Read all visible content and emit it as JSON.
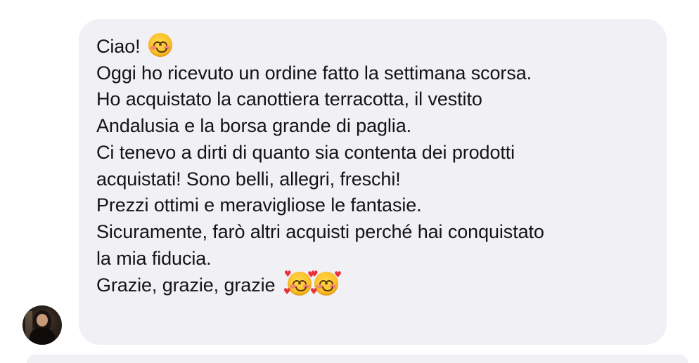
{
  "message": {
    "lines": [
      "Ciao!",
      "Oggi ho ricevuto un ordine fatto la settimana scorsa.",
      "Ho acquistato la canottiera terracotta, il vestito",
      "Andalusia e la borsa grande di paglia.",
      "Ci tenevo a dirti di quanto sia contenta dei prodotti",
      "acquistati! Sono belli, allegri, freschi!",
      "Prezzi ottimi e meravigliose le fantasie.",
      "Sicuramente, farò altri acquisti perché hai conquistato",
      "la mia fiducia.",
      "Grazie, grazie, grazie"
    ],
    "emoji_after_line_1": "smiling-face-icon",
    "emoji_after_last_line": [
      "smiling-face-with-hearts-icon",
      "smiling-face-with-hearts-icon"
    ]
  },
  "colors": {
    "bubble_background": "#f0f0f5",
    "text": "#141414"
  }
}
